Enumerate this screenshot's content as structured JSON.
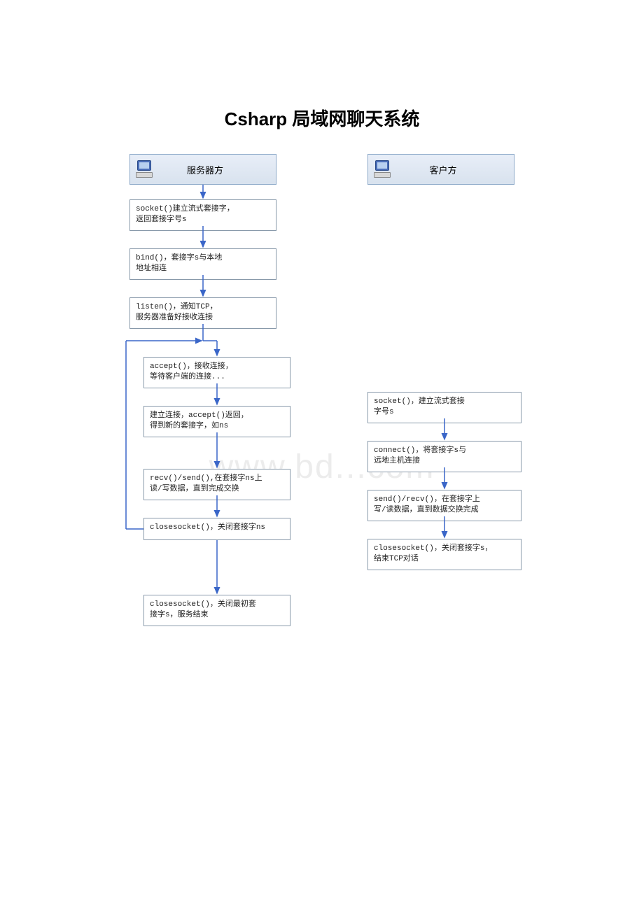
{
  "title": "Csharp 局域网聊天系统",
  "watermark": "www.bd...com",
  "server": {
    "header": "服务器方",
    "steps": [
      "socket()建立流式套接字，\n返回套接字号s",
      "bind()，套接字s与本地\n地址相连",
      "listen()，通知TCP，\n服务器准备好接收连接",
      "accept()，接收连接，\n等待客户端的连接...",
      "建立连接，accept()返回，\n得到新的套接字，如ns",
      "recv()/send(),在套接字ns上\n读/写数据，直到完成交换",
      "closesocket()，关闭套接字ns",
      "closesocket()，关闭最初套\n接字s，服务结束"
    ]
  },
  "client": {
    "header": "客户方",
    "steps": [
      "socket()，建立流式套接\n字号s",
      "connect()，将套接字s与\n远地主机连接",
      "send()/recv()，在套接字上\n写/读数据，直到数据交换完成",
      "closesocket()，关闭套接字s，\n结束TCP对话"
    ]
  }
}
